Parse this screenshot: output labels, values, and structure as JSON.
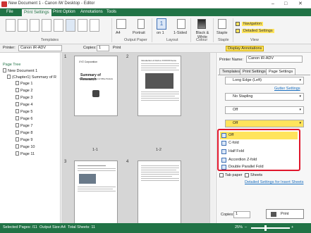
{
  "window": {
    "title": "New Document 1 - Canon iW Desktop - Editor",
    "minimize": "–",
    "maximize": "□",
    "close": "✕"
  },
  "menu": [
    "File",
    "Print Settings",
    "Print Option",
    "Annotations",
    "Tools"
  ],
  "ribbon": {
    "templates_label": "Templates",
    "output_paper_label": "Output Paper",
    "paper_size": "A4",
    "orientation": "Portrait",
    "layout_label": "Layout",
    "pages_per_sheet": "1",
    "pages_on": "on 1",
    "sided": "1-Sided",
    "color_label": "Colour",
    "color_mode": "Black & White",
    "staple_label": "Staple",
    "staple": "Staple",
    "view_label": "View",
    "navigation": "Navigation",
    "detailed_settings": "Detailed Settings"
  },
  "printerbar": {
    "printer_label": "Printer:",
    "printer": "Canon iR-ADV",
    "copies_label": "Copies:",
    "copies": "1",
    "print": "Print",
    "display_annotations": "Display Annotations"
  },
  "tree": {
    "header": "Page Tree",
    "root": "New Document 1",
    "chapter": "(Chapter1) Summary of R",
    "pages": [
      "Page 1",
      "Page 2",
      "Page 3",
      "Page 4",
      "Page 5",
      "Page 6",
      "Page 7",
      "Page 8",
      "Page 9",
      "Page 10",
      "Page 11"
    ]
  },
  "center": {
    "sheet1": "1",
    "sheet2": "2",
    "sheet3": "3",
    "sheet4": "4",
    "label1": "1-1",
    "label2": "1-2",
    "page1_company": "XYZ Corporation",
    "page1_title": "Summary of Research",
    "page1_subtitle": "Sales Data Management of Office Products",
    "page2_title": "Introduction of AAA to XXXXXX Items"
  },
  "right": {
    "printer_name_label": "Printer Name:",
    "printer_name": "Canon iR-ADV",
    "tabs": [
      "Templates",
      "Print Settings",
      "Page Settings"
    ],
    "long_edge": "Long Edge (Left)",
    "gutter_settings": "Gutter Settings",
    "no_stapling": "No Stapling",
    "off1": "Off",
    "off2": "Off",
    "options": [
      "Off",
      "C-fold",
      "Half Fold",
      "Accordion Z-fold",
      "Double Parallel Fold"
    ],
    "tab_paper": "Tab paper",
    "sheets": "Sheets",
    "detailed_insert": "Detailed Settings for Insert Sheets",
    "copies_label": "Copies:",
    "copies": "1",
    "print": "Print"
  },
  "status": {
    "selected": "Selected Pages: /11",
    "output_size": "Output Size:A4",
    "total": "Total Sheets: 11",
    "zoom": "25%"
  }
}
